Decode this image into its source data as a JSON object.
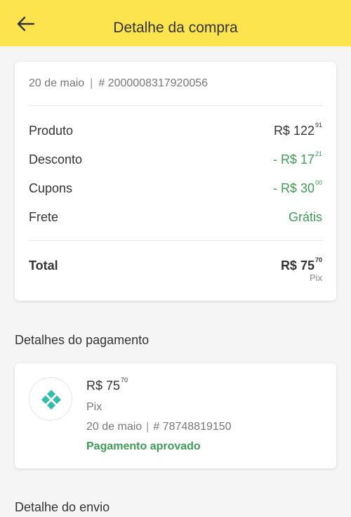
{
  "header": {
    "title": "Detalhe da compra",
    "back_icon": "arrow-left-icon",
    "background": "#fce44f"
  },
  "summary": {
    "date": "20 de maio",
    "separator": "|",
    "order_number": "# 2000008317920056",
    "rows": [
      {
        "label": "Produto",
        "prefix": "",
        "amount": "R$ 122",
        "cents": "91",
        "color": "#333333"
      },
      {
        "label": "Desconto",
        "prefix": "- ",
        "amount": "R$ 17",
        "cents": "21",
        "color": "#3f9c57"
      },
      {
        "label": "Cupons",
        "prefix": "- ",
        "amount": "R$ 30",
        "cents": "00",
        "color": "#3f9c57"
      },
      {
        "label": "Frete",
        "value": "Grátis",
        "color": "#3f9c57"
      }
    ],
    "total": {
      "label": "Total",
      "amount": "R$ 75",
      "cents": "70",
      "method": "Pix"
    }
  },
  "payment": {
    "section_title": "Detalhes do pagamento",
    "icon": "pix-icon",
    "amount": "R$ 75",
    "cents": "70",
    "method": "Pix",
    "date": "20 de maio",
    "separator": "|",
    "transaction_number": "# 78748819150",
    "status": "Pagamento aprovado",
    "status_color": "#3f9c57"
  },
  "shipping": {
    "section_title": "Detalhe do envio"
  }
}
